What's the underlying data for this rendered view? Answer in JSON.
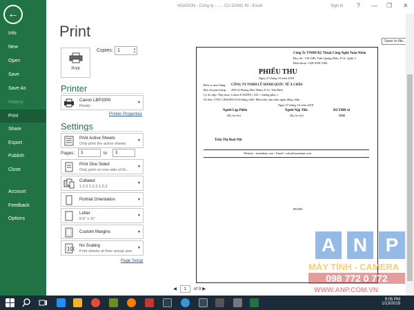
{
  "titlebar": {
    "title": "HOADON - Cong ty - ... - CU DANG IN - Excel",
    "signin": "Sign in",
    "help": "?",
    "minimize": "—",
    "restore": "❐",
    "close": "✕"
  },
  "nav": {
    "back_glyph": "←",
    "items": [
      {
        "label": "Info"
      },
      {
        "label": "New"
      },
      {
        "label": "Open"
      },
      {
        "label": "Save"
      },
      {
        "label": "Save As"
      },
      {
        "label": "History"
      },
      {
        "label": "Print"
      },
      {
        "label": "Share"
      },
      {
        "label": "Export"
      },
      {
        "label": "Publish"
      },
      {
        "label": "Close"
      },
      {
        "label": "Account"
      },
      {
        "label": "Feedback"
      },
      {
        "label": "Options"
      }
    ]
  },
  "print": {
    "heading": "Print",
    "button_label": "Print",
    "copies_label": "Copies:",
    "copies_value": "1"
  },
  "printer": {
    "section": "Printer",
    "name": "Canon LBP3300",
    "status": "Ready",
    "properties_link": "Printer Properties"
  },
  "settings": {
    "section": "Settings",
    "what": {
      "l1": "Print Active Sheets",
      "l2": "Only print the active sheets"
    },
    "pages_label": "Pages:",
    "pages_from": "1",
    "pages_to_label": "to",
    "pages_to": "1",
    "sides": {
      "l1": "Print One Sided",
      "l2": "Only print on one side of th..."
    },
    "collate": {
      "l1": "Collated",
      "l2": "1,2,3   1,2,3   1,2,3"
    },
    "orientation": {
      "l1": "Portrait Orientation"
    },
    "paper": {
      "l1": "Letter",
      "l2": "8.5\" x 11\""
    },
    "margins": {
      "l1": "Custom Margins"
    },
    "scaling": {
      "l1": "No Scaling",
      "l2": "Print sheets at their actual size"
    },
    "page_setup_link": "Page Setup"
  },
  "preview": {
    "tooltip": "Save to file...",
    "company": "Công Ty TNHH Kỹ Thuật Công Nghệ Toàn Nhân",
    "address": "Địa chỉ : 136 54B, Trần Quang Diệu, P.14, Quận 3",
    "phone": "Điện thoại : 028.3930.3384",
    "doc_title": "PHIẾU THU",
    "date_line": "Ngày 27 tháng 10 năm 2018",
    "payer": "Đơn vị mua hàng:",
    "payer_value": "CÔNG TY TNHH LỮ HÀNH QUỐC TẾ Á CHÂU",
    "addr_label": "Địa chỉ giao hàng:",
    "addr_value": "209/14 Hoàng Hoa Thám, P.12, Tân Bình",
    "reason": "Lý do nộp: Nộp mua: Canon 8.3KDW ( 232 + không phục )",
    "amount": "Số tiền:    VND  1,800,000    (Viết bằng chữ): Một triệu tám trăm ngàn đồng chẵn",
    "date_line2": "Ngày 27 tháng 10 năm 2018",
    "sig1": "Người Lập Phiếu",
    "sig2": "Người Nộp Tiền",
    "sig3": "Đã XMĐ số",
    "sig1_sub": "(Ký, họ tên)",
    "sig2_sub": "(Ký, họ tên)",
    "sig3_sub": "2245",
    "signer": "Trần Thị Hoài Nhi",
    "footer": "Website : toannhan.com - Email : info@toannhan.com",
    "page_code": "881000"
  },
  "pager": {
    "prev": "◀",
    "current": "1",
    "of": "of 9",
    "next": "▶"
  },
  "watermark": {
    "letters": [
      "A",
      "N",
      "P"
    ],
    "line": "MÁY TÍNH - CAMERA",
    "phone": "098 772 0 772",
    "web": "WWW.ANP.COM.VN"
  },
  "taskbar": {
    "time": "9:05 PM",
    "date": "1/13/2019"
  },
  "colors": {
    "accent": "#217346",
    "taskbar": "#1c2b3a",
    "link": "#2b579a"
  }
}
